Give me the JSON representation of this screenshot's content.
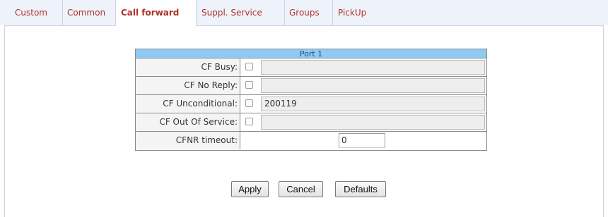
{
  "tabs": [
    {
      "label": "Custom"
    },
    {
      "label": "Common"
    },
    {
      "label": "Call forward",
      "active": true
    },
    {
      "label": "Suppl. Service"
    },
    {
      "label": "Groups"
    },
    {
      "label": "PickUp"
    }
  ],
  "colors": {
    "tab_text": "#b0302a",
    "tab_bar_bg": "#eef3fb",
    "port_header_bg": "#8fcaf2"
  },
  "port": {
    "title": "Port 1",
    "rows": [
      {
        "label": "CF Busy:",
        "checked": false,
        "value": ""
      },
      {
        "label": "CF No Reply:",
        "checked": false,
        "value": ""
      },
      {
        "label": "CF Unconditional:",
        "checked": false,
        "value": "200119"
      },
      {
        "label": "CF Out Of Service:",
        "checked": false,
        "value": ""
      }
    ],
    "timeout": {
      "label": "CFNR timeout:",
      "value": "0"
    }
  },
  "buttons": {
    "apply": "Apply",
    "cancel": "Cancel",
    "defaults": "Defaults"
  }
}
